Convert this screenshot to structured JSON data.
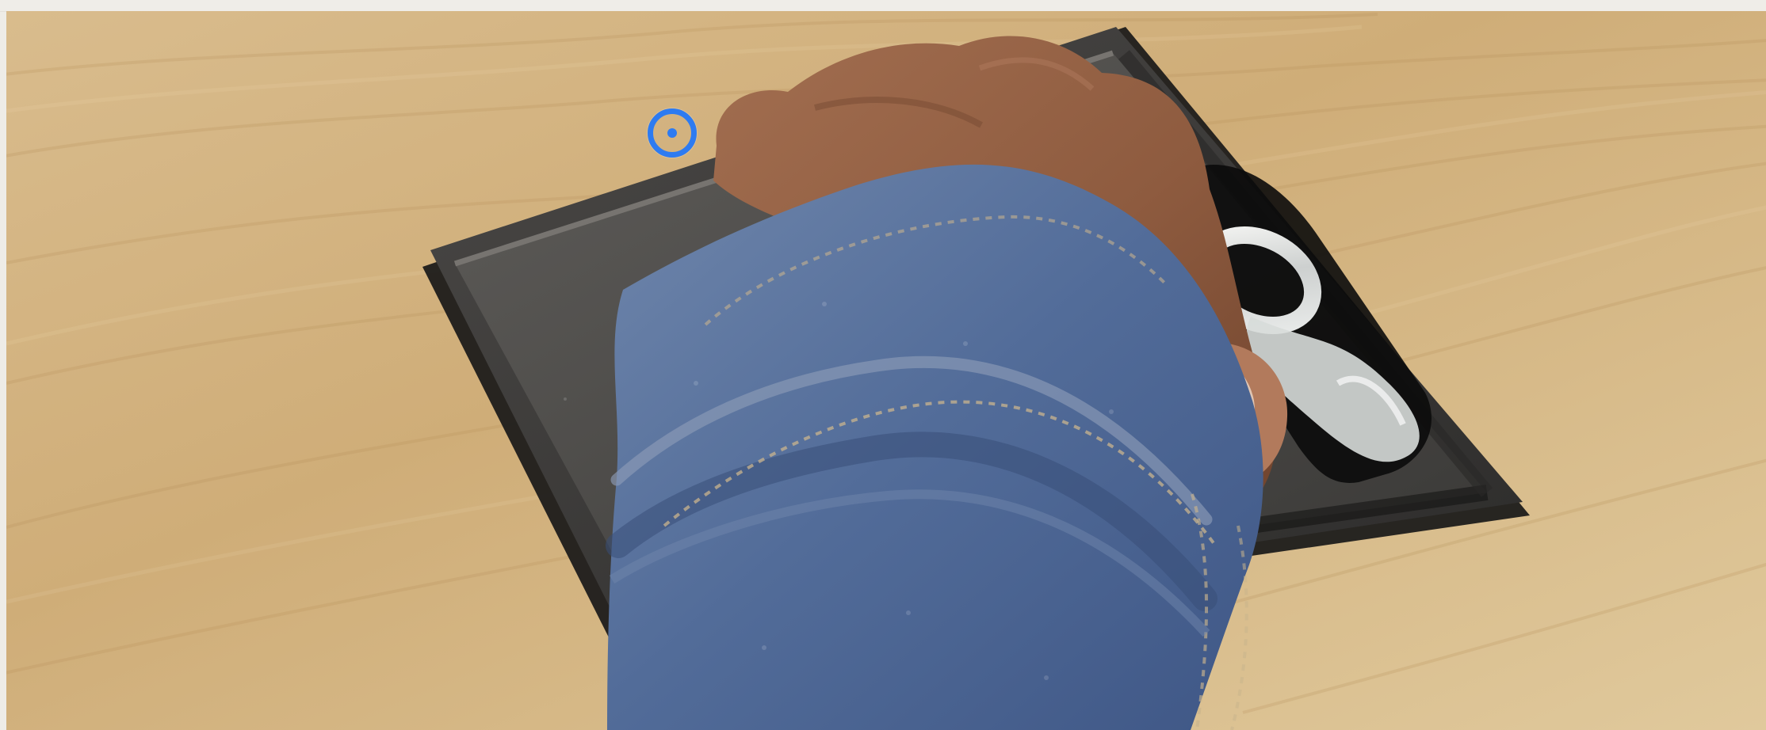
{
  "screen": {
    "background_color": "#eeece7",
    "accent_color": "#2d7bf1"
  },
  "video": {
    "content": "product-demo-frame"
  },
  "controls": {
    "focus_marker": {
      "icon": "target-icon"
    }
  }
}
